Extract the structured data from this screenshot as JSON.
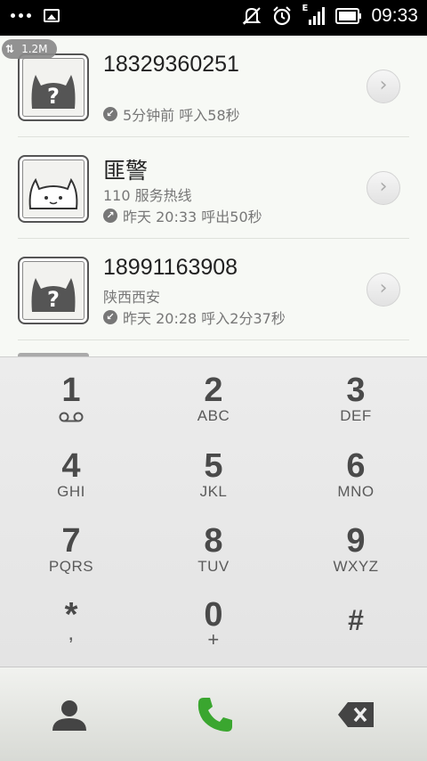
{
  "status_bar": {
    "time": "09:33",
    "network_label": "E",
    "icons": [
      "menu-dots-icon",
      "image-notification-icon",
      "vibrate-off-icon",
      "alarm-icon",
      "signal-icon",
      "battery-icon"
    ]
  },
  "traffic_badge": {
    "arrows": "⇅",
    "value": "1.2M"
  },
  "calls": [
    {
      "number": "18329360251",
      "subtitle": "",
      "meta": "5分钟前 呼入58秒",
      "direction": "incoming",
      "avatar": "unknown-cat-icon"
    },
    {
      "number": "匪警",
      "subtitle": "110 服务热线",
      "meta": "昨天 20:33 呼出50秒",
      "direction": "outgoing",
      "avatar": "cat-icon"
    },
    {
      "number": "18991163908",
      "subtitle": "陕西西安",
      "meta": "昨天 20:28 呼入2分37秒",
      "direction": "incoming",
      "avatar": "unknown-cat-icon"
    }
  ],
  "dialpad": {
    "keys": [
      {
        "digit": "1",
        "letters": ""
      },
      {
        "digit": "2",
        "letters": "ABC"
      },
      {
        "digit": "3",
        "letters": "DEF"
      },
      {
        "digit": "4",
        "letters": "GHI"
      },
      {
        "digit": "5",
        "letters": "JKL"
      },
      {
        "digit": "6",
        "letters": "MNO"
      },
      {
        "digit": "7",
        "letters": "PQRS"
      },
      {
        "digit": "8",
        "letters": "TUV"
      },
      {
        "digit": "9",
        "letters": "WXYZ"
      },
      {
        "digit": "*",
        "letters": ","
      },
      {
        "digit": "0",
        "letters": "+"
      },
      {
        "digit": "#",
        "letters": ""
      }
    ]
  },
  "colors": {
    "call_button": "#3aa62f",
    "status_bar": "#000000"
  }
}
